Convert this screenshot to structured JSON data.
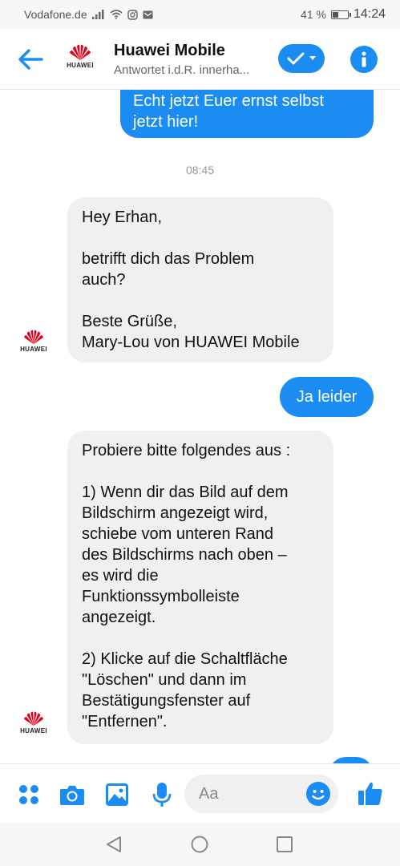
{
  "status_bar": {
    "carrier": "Vodafone.de",
    "battery_text": "41 %",
    "battery_level": 0.41,
    "time": "14:24"
  },
  "header": {
    "contact_name": "Huawei Mobile",
    "subtitle": "Antwortet i.d.R. innerha...",
    "logo_text": "HUAWEI"
  },
  "messages": [
    {
      "direction": "outgoing",
      "text": "Echt jetzt Euer ernst selbst\njetzt hier!"
    },
    {
      "direction": "timestamp",
      "text": "08:45"
    },
    {
      "direction": "incoming",
      "text": "Hey Erhan,\n\nbetrifft dich das Problem\nauch?\n\nBeste Grüße,\nMary-Lou von HUAWEI Mobile"
    },
    {
      "direction": "outgoing",
      "text": "Ja leider"
    },
    {
      "direction": "incoming",
      "text": "Probiere bitte folgendes aus :\n\n1) Wenn dir das Bild auf dem\nBildschirm angezeigt wird,\nschiebe vom unteren Rand\ndes Bildschirms nach oben –\nes wird die\nFunktionssymbolleiste\nangezeigt.\n\n2) Klicke auf die Schaltfläche\n\"Löschen\" und dann im\nBestätigungsfenster auf\n\"Entfernen\"."
    }
  ],
  "composer": {
    "placeholder": "Aa"
  },
  "colors": {
    "accent": "#1a8cf2",
    "incoming_bubble": "#f0f0f0",
    "huawei_red": "#e3001b"
  },
  "icons": {
    "back": "arrow-left-icon",
    "check": "check-icon",
    "info": "info-icon",
    "apps": "four-dots-icon",
    "camera": "camera-icon",
    "gallery": "image-icon",
    "mic": "microphone-icon",
    "emoji": "smiley-icon",
    "like": "thumbs-up-icon"
  }
}
